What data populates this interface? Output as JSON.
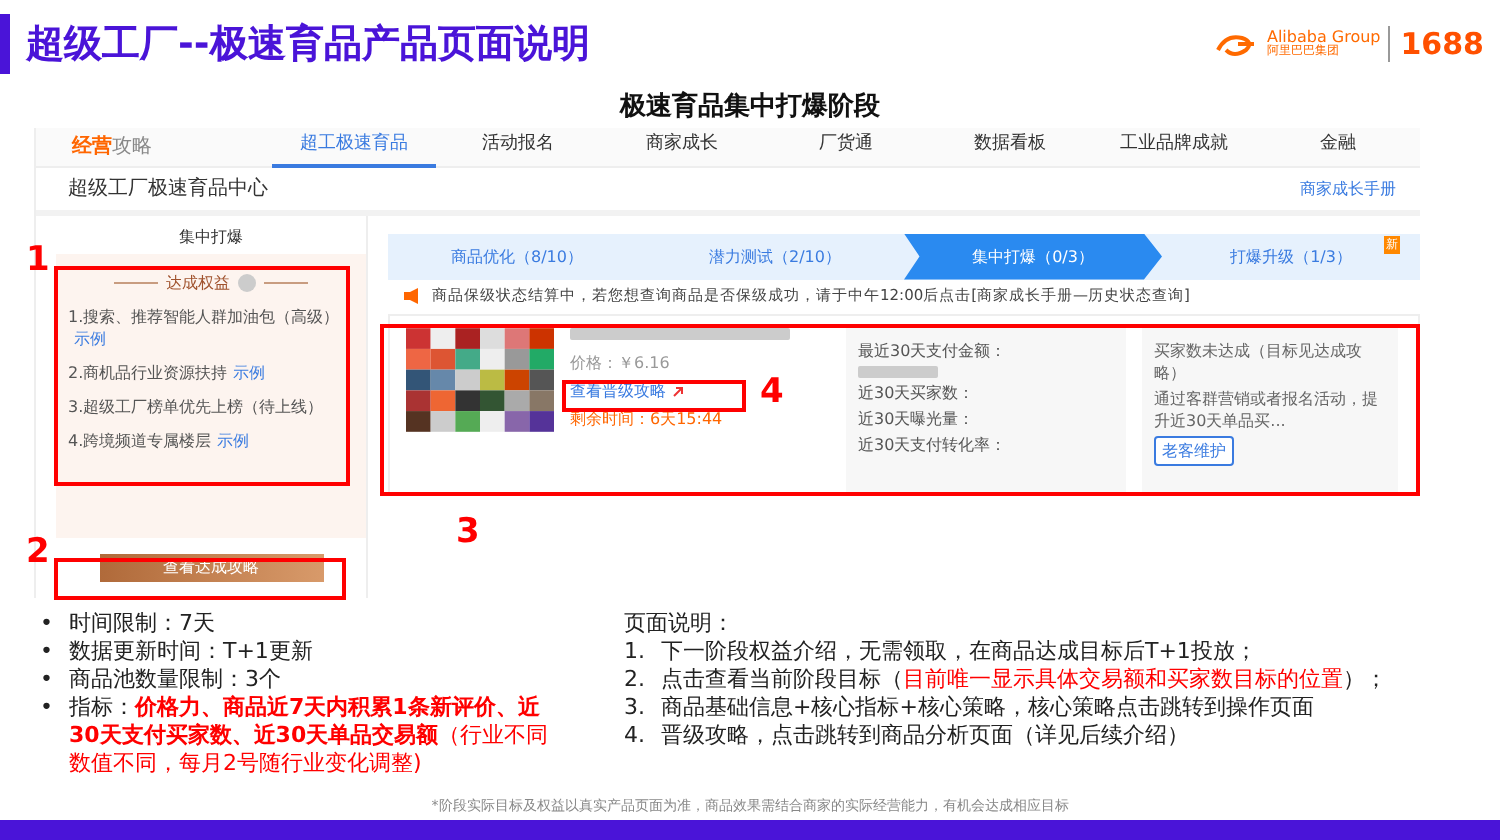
{
  "slide": {
    "title": "超级工厂--极速育品产品页面说明",
    "subtitle": "极速育品集中打爆阶段",
    "logo": {
      "brand": "Alibaba Group",
      "brand_cn": "阿里巴巴集团",
      "site": "1688"
    }
  },
  "screenshot": {
    "nav": {
      "logo_a": "经营",
      "logo_b": "攻略",
      "tabs": [
        {
          "label": "超工极速育品",
          "selected": true
        },
        {
          "label": "活动报名",
          "selected": false
        },
        {
          "label": "商家成长",
          "selected": false
        },
        {
          "label": "厂货通",
          "selected": false
        },
        {
          "label": "数据看板",
          "selected": false
        },
        {
          "label": "工业品牌成就",
          "selected": false
        },
        {
          "label": "金融",
          "selected": false
        }
      ]
    },
    "header": {
      "title": "超级工厂极速育品中心",
      "link": "商家成长手册"
    },
    "left_panel": {
      "title": "集中打爆",
      "benefits_title": "达成权益",
      "benefits": [
        {
          "text": "1.搜索、推荐智能人群加油包（高级）",
          "link": "示例"
        },
        {
          "text": "2.商机品行业资源扶持",
          "link": "示例"
        },
        {
          "text": "3.超级工厂榜单优先上榜（待上线）"
        },
        {
          "text": "4.跨境频道专属楼层",
          "link": "示例"
        }
      ],
      "button": "查看达成攻略"
    },
    "steps": [
      {
        "label": "商品优化（8/10）",
        "selected": false
      },
      {
        "label": "潜力测试（2/10）",
        "selected": false
      },
      {
        "label": "集中打爆（0/3）",
        "selected": true
      },
      {
        "label": "打爆升级（1/3）",
        "selected": false,
        "badge": "新"
      }
    ],
    "notice": "商品保级状态结算中，若您想查询商品是否保级成功，请于中午12:00后点击[商家成长手册—历史状态查询]",
    "product": {
      "price_label": "价格：",
      "price": "￥6.16",
      "strategy_link": "查看晋级攻略",
      "time_label": "剩余时间：",
      "time": "6天15:44",
      "metrics": [
        "最近30天支付金额：",
        "近30天买家数：",
        "近30天曝光量：",
        "近30天支付转化率："
      ],
      "advice": {
        "title": "买家数未达成（目标见达成攻略）",
        "text": "通过客群营销或者报名活动，提升近30天单品买...",
        "button": "老客维护"
      }
    }
  },
  "annotations": [
    {
      "label": "1"
    },
    {
      "label": "2"
    },
    {
      "label": "3"
    },
    {
      "label": "4"
    }
  ],
  "notes_left": [
    {
      "kind": "plain",
      "bullet": "•",
      "text": "时间限制：7天"
    },
    {
      "kind": "plain",
      "bullet": "•",
      "text": "数据更新时间：T+1更新"
    },
    {
      "kind": "plain",
      "bullet": "•",
      "text": "商品池数量限制：3个"
    },
    {
      "kind": "metric",
      "bullet": "•",
      "label": "指标：",
      "text": "**价格力、商品近7天内积累1条新评价、近30天支付买家数、近30天单品交易额**（行业不同数值不同，每月2号随行业变化调整)"
    }
  ],
  "notes_right": {
    "title": "页面说明：",
    "items": [
      {
        "num": "1.",
        "text": "下一阶段权益介绍，无需领取，在商品达成目标后T+1投放；"
      },
      {
        "num": "2.",
        "text": "点击查看当前阶段目标（",
        "highlight": "目前唯一显示具体交易额和买家数目标的位置",
        "after": "）；"
      },
      {
        "num": "3.",
        "text": "商品基础信息+核心指标+核心策略，核心策略点击跳转到操作页面"
      },
      {
        "num": "4.",
        "text": "晋级攻略，点击跳转到商品分析页面（详见后续介绍）"
      }
    ]
  },
  "footnote": "*阶段实际目标及权益以真实产品页面为准，商品效果需结合商家的实际经营能力，有机会达成相应目标"
}
